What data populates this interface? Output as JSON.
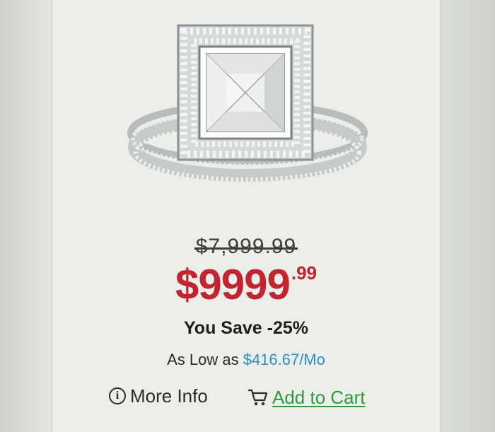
{
  "product": {
    "image_alt": "princess-cut halo diamond ring set",
    "original_price": "$7,999.99",
    "sale_price_main": "$9999",
    "sale_price_cents": ".99",
    "you_save": "You Save -25%",
    "financing_prefix": "As Low as ",
    "financing_amount": "$416.67/Mo"
  },
  "actions": {
    "more_info_label": "More Info",
    "add_to_cart_label": "Add to Cart"
  },
  "icons": {
    "info": "info-circle-icon",
    "cart": "shopping-cart-icon"
  },
  "colors": {
    "sale_price": "#c22430",
    "financing_amount": "#2a8fc6",
    "add_to_cart": "#2e9a3f"
  }
}
